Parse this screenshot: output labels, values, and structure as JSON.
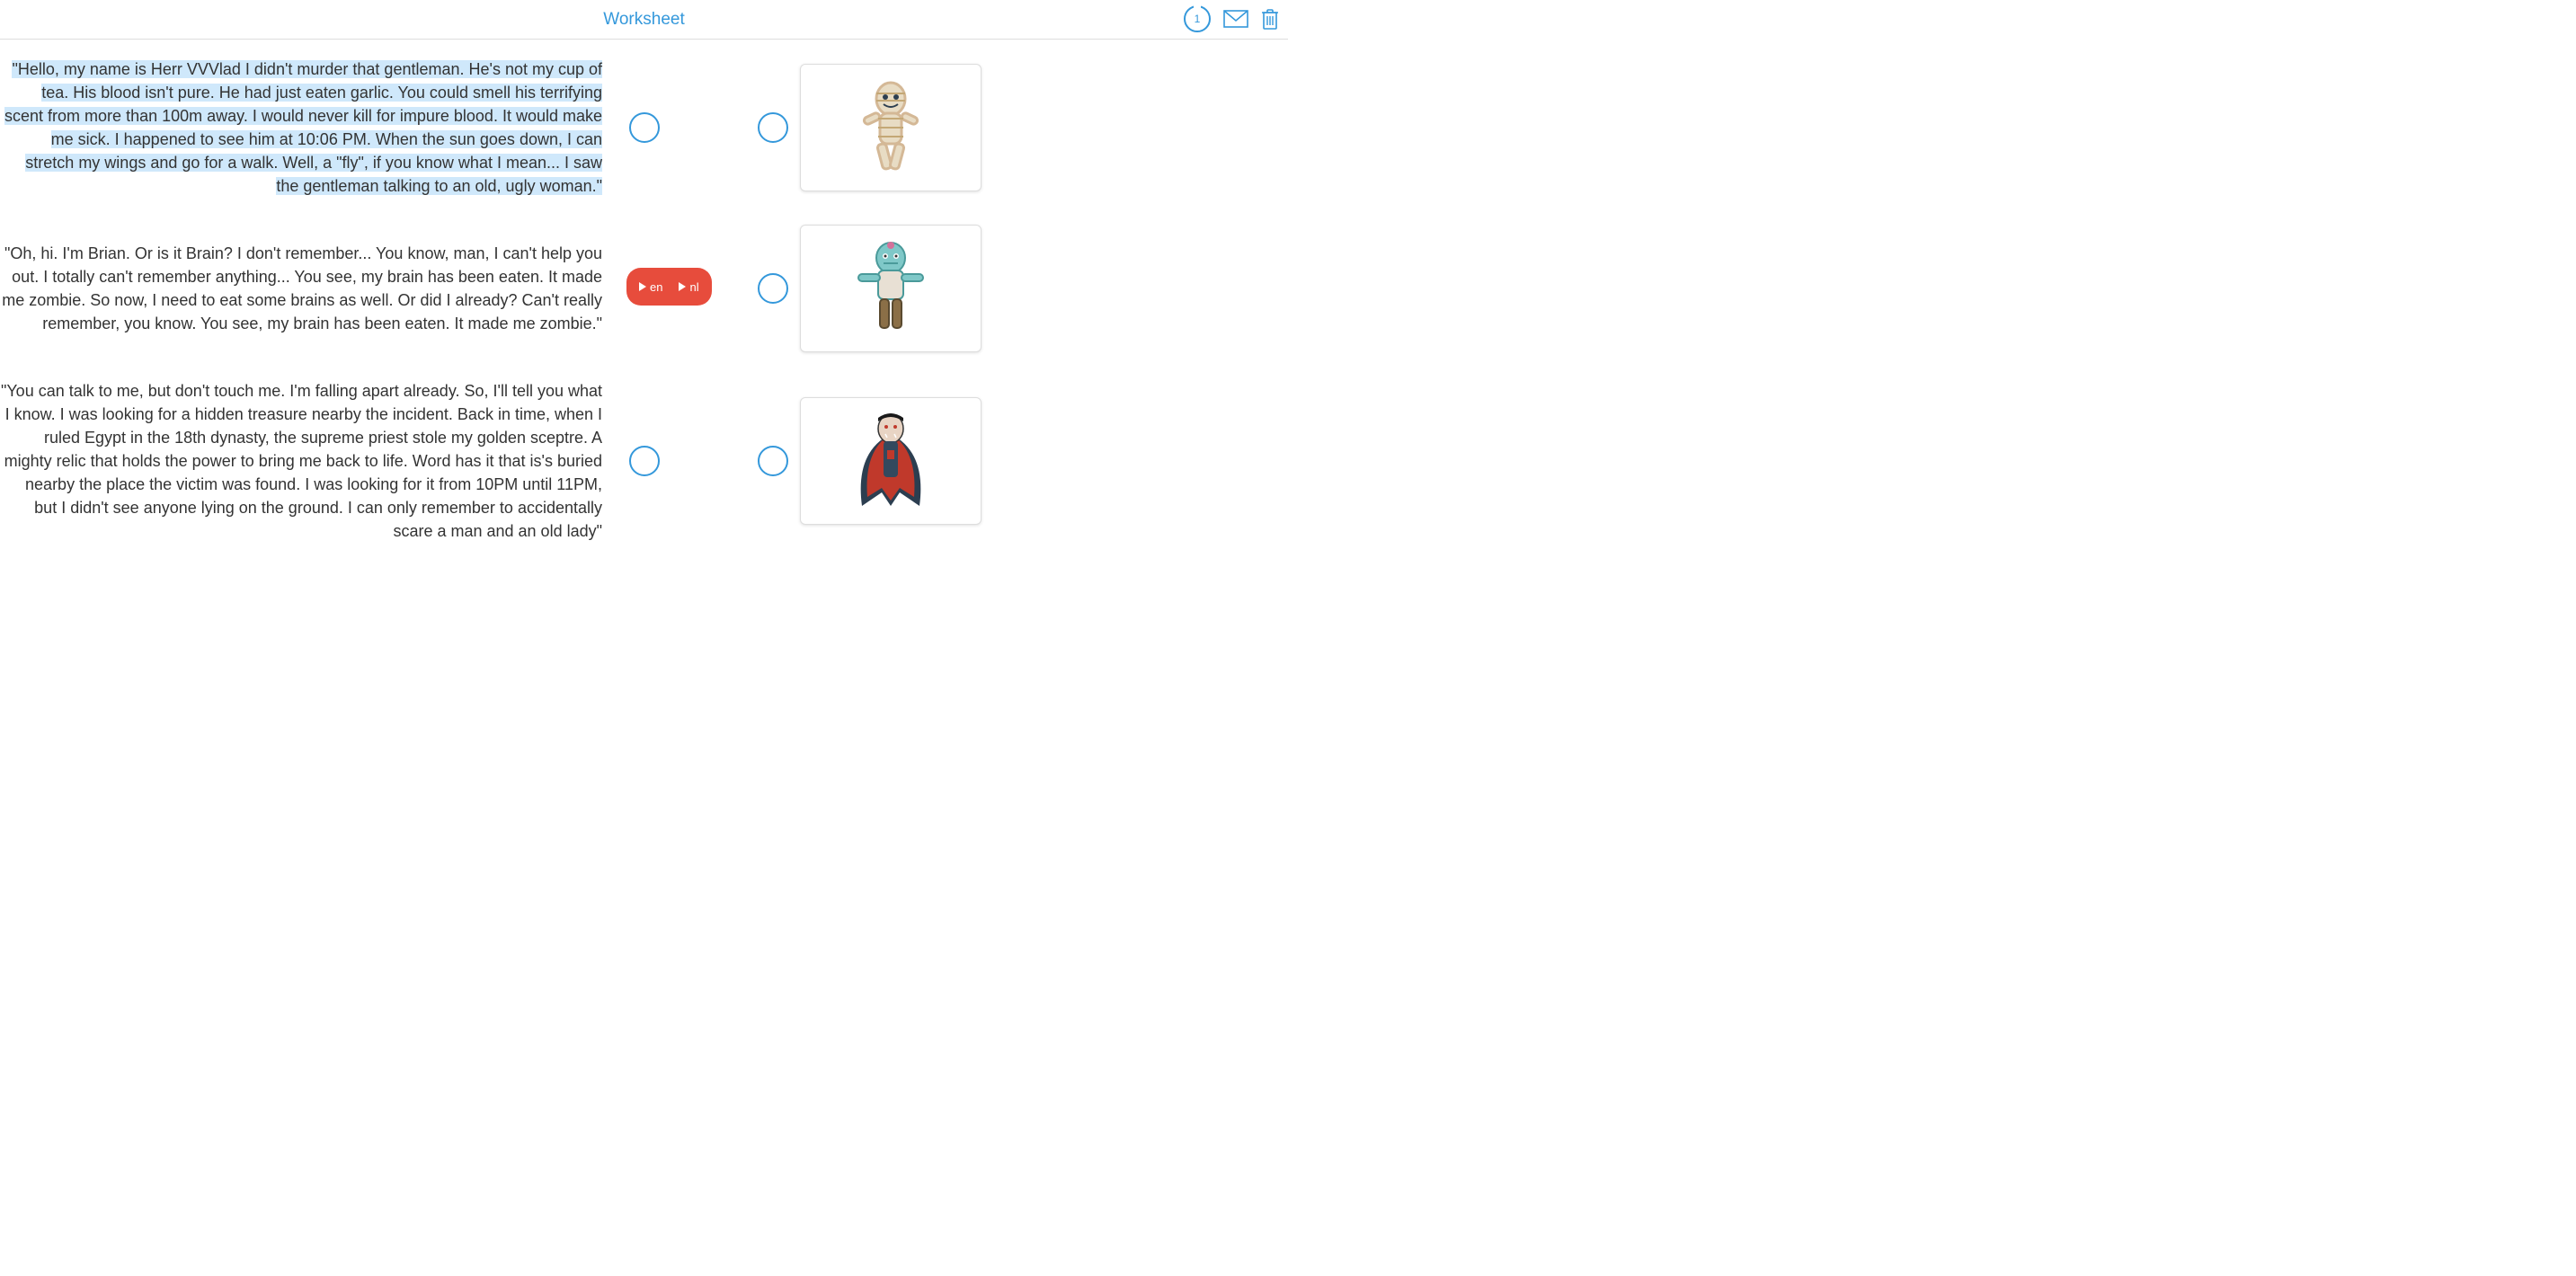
{
  "header": {
    "title": "Worksheet",
    "badge_count": "1"
  },
  "audio": {
    "lang1": "en",
    "lang2": "nl"
  },
  "items": [
    {
      "text": "\"Hello, my name is Herr VVVlad I didn't murder that gentleman. He's not my cup of tea. His blood isn't pure. He had just eaten garlic. You could smell his terrifying scent from more than 100m away. I would never kill for impure blood. It would make me sick. I happened to see him at 10:06 PM. When the sun goes down, I can stretch my wings and go for a walk. Well, a \"fly\", if you know what I mean... I saw the gentleman talking to an old, ugly woman.\"",
      "selected": true,
      "image": "mummy"
    },
    {
      "text": "\"Oh, hi. I'm Brian. Or is it Brain? I don't remember... You know, man, I can't help you out. I totally can't remember anything... You see, my brain has been eaten. It made me zombie. So now, I need to eat some brains as well. Or did I already? Can't really remember, you know. You see, my brain has been eaten. It made me zombie.\"",
      "selected": false,
      "image": "zombie"
    },
    {
      "text": "\"You can talk to me, but don't touch me. I'm falling apart already. So, I'll tell you what I know. I was looking for a hidden treasure nearby the incident. Back in time, when I ruled Egypt in the 18th dynasty, the supreme priest stole my golden sceptre. A mighty relic that holds the power to bring me back to life. Word has it that is's buried nearby the place the victim was found. I was looking for it from 10PM until 11PM, but I didn't see anyone lying on the ground. I can only remember to accidentally scare a man and an old lady\"",
      "selected": false,
      "image": "vampire"
    }
  ]
}
